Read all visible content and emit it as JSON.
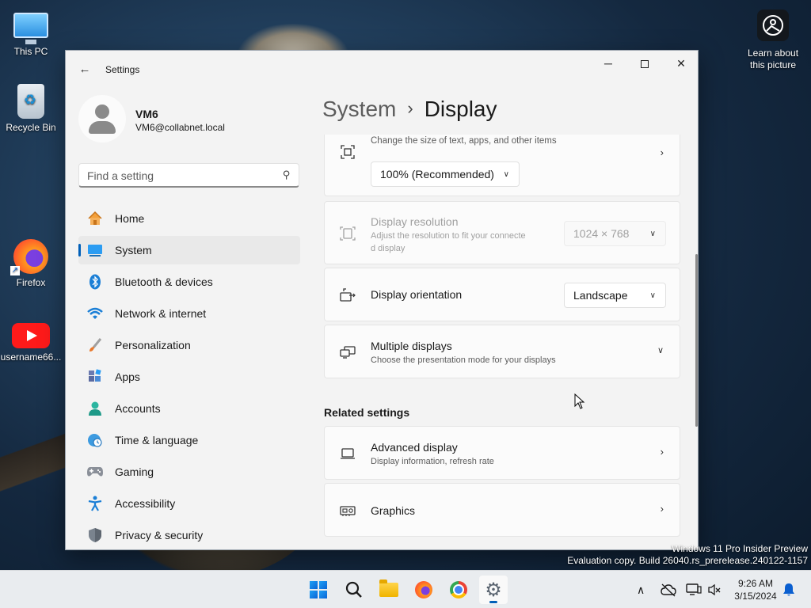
{
  "desktop": {
    "icons": [
      {
        "label": "This PC"
      },
      {
        "label": "Recycle Bin"
      },
      {
        "label": "Firefox"
      },
      {
        "label": "username66..."
      }
    ],
    "learn_label_line1": "Learn about",
    "learn_label_line2": "this picture",
    "watermark_line1": "Windows 11 Pro Insider Preview",
    "watermark_line2": "Evaluation copy. Build 26040.rs_prerelease.240122-1157"
  },
  "window": {
    "title": "Settings",
    "back_icon": "←",
    "minimize_icon": "─",
    "close_icon": "✕"
  },
  "user": {
    "name": "VM6",
    "email": "VM6@collabnet.local"
  },
  "search": {
    "placeholder": "Find a setting",
    "value": ""
  },
  "sidebar": {
    "items": [
      {
        "label": "Home",
        "icon": "home-icon",
        "active": false
      },
      {
        "label": "System",
        "icon": "monitor-icon",
        "active": true
      },
      {
        "label": "Bluetooth & devices",
        "icon": "bluetooth-icon",
        "active": false
      },
      {
        "label": "Network & internet",
        "icon": "wifi-icon",
        "active": false
      },
      {
        "label": "Personalization",
        "icon": "brush-icon",
        "active": false
      },
      {
        "label": "Apps",
        "icon": "apps-icon",
        "active": false
      },
      {
        "label": "Accounts",
        "icon": "person-icon",
        "active": false
      },
      {
        "label": "Time & language",
        "icon": "globe-clock-icon",
        "active": false
      },
      {
        "label": "Gaming",
        "icon": "controller-icon",
        "active": false
      },
      {
        "label": "Accessibility",
        "icon": "accessibility-icon",
        "active": false
      },
      {
        "label": "Privacy & security",
        "icon": "shield-icon",
        "active": false
      }
    ]
  },
  "breadcrumb": {
    "parent": "System",
    "separator": "›",
    "current": "Display"
  },
  "main": {
    "scale": {
      "subtitle": "Change the size of text, apps, and other items",
      "value": "100% (Recommended)"
    },
    "resolution": {
      "title": "Display resolution",
      "subtitle_line1": "Adjust the resolution to fit your connecte",
      "subtitle_line2": "d display",
      "value": "1024 × 768",
      "disabled": true
    },
    "orientation": {
      "title": "Display orientation",
      "value": "Landscape"
    },
    "multiple": {
      "title": "Multiple displays",
      "subtitle": "Choose the presentation mode for your displays"
    },
    "related_title": "Related settings",
    "advanced": {
      "title": "Advanced display",
      "subtitle": "Display information, refresh rate"
    },
    "graphics": {
      "title": "Graphics"
    }
  },
  "taskbar": {
    "time": "9:26 AM",
    "date": "3/15/2024"
  },
  "colors": {
    "accent": "#005fb8",
    "window_bg": "#f3f3f3",
    "card_bg": "#fbfbfb"
  }
}
